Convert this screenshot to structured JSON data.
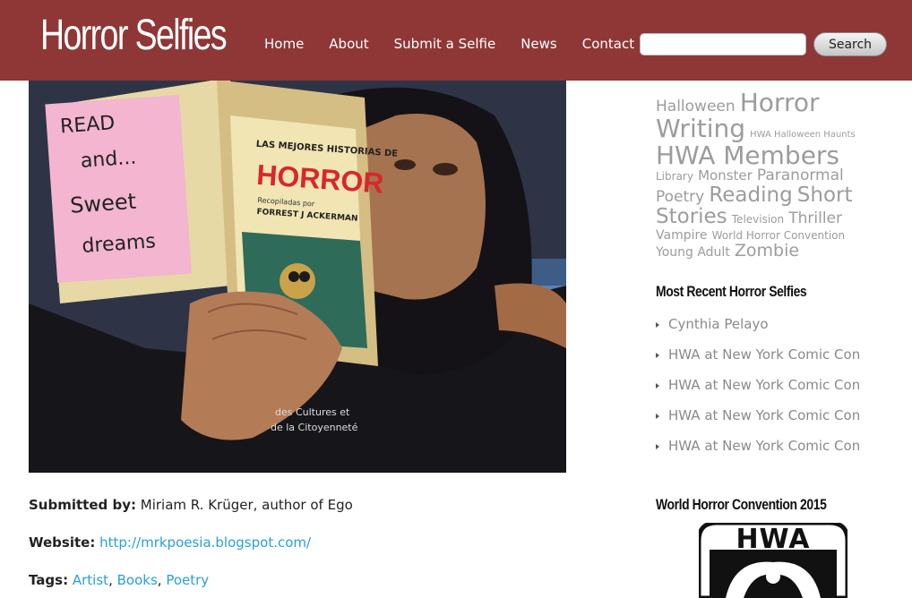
{
  "header": {
    "site_title": "Horror Selfies",
    "nav": [
      "Home",
      "About",
      "Submit a Selfie",
      "News",
      "Contact"
    ],
    "search_value": "",
    "search_button": "Search",
    "color": "#8e3736"
  },
  "photo": {
    "note_lines": [
      "READ",
      "and...",
      "Sweet",
      "dreams"
    ],
    "book_title": "LAS MEJORES HISTORIAS DE",
    "book_subtitle": "HORROR",
    "book_editor_label": "Recopiladas por",
    "book_editor": "FORREST J ACKERMAN",
    "shirt_line1": "des Cultures et",
    "shirt_line2": "de la Citoyenneté"
  },
  "post": {
    "submitted_label": "Submitted by:",
    "submitted_value": "Miriam R. Krüger, author of Ego",
    "website_label": "Website:",
    "website_url": "http://mrkpoesia.blogspot.com/",
    "tags_label": "Tags:",
    "tags": [
      "Artist",
      "Books",
      "Poetry"
    ]
  },
  "sidebar": {
    "tag_cloud": [
      {
        "label": "Halloween",
        "size": 17
      },
      {
        "label": "Horror Writing",
        "size": 28
      },
      {
        "label": "HWA Halloween Haunts",
        "size": 10
      },
      {
        "label": "HWA Members",
        "size": 28
      },
      {
        "label": "Library",
        "size": 12
      },
      {
        "label": "Monster",
        "size": 15
      },
      {
        "label": "Paranormal",
        "size": 17
      },
      {
        "label": "Poetry",
        "size": 17
      },
      {
        "label": "Reading",
        "size": 23
      },
      {
        "label": "Short Stories",
        "size": 23
      },
      {
        "label": "Television",
        "size": 12
      },
      {
        "label": "Thriller",
        "size": 17
      },
      {
        "label": "Vampire",
        "size": 14
      },
      {
        "label": "World Horror Convention",
        "size": 12
      },
      {
        "label": "Young Adult",
        "size": 14
      },
      {
        "label": "Zombie",
        "size": 19
      }
    ],
    "recent_title": "Most Recent Horror Selfies",
    "recent": [
      "Cynthia Pelayo",
      "HWA at New York Comic Con",
      "HWA at New York Comic Con",
      "HWA at New York Comic Con",
      "HWA at New York Comic Con"
    ],
    "whc_title": "World Horror Convention 2015",
    "logo_text": "HWA"
  }
}
